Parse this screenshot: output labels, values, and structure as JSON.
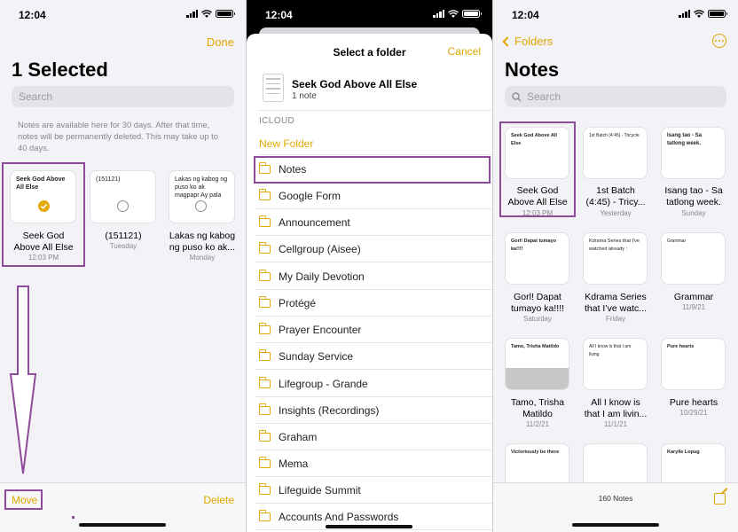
{
  "status": {
    "time": "12:04"
  },
  "panel1": {
    "done": "Done",
    "title": "1 Selected",
    "search_placeholder": "Search",
    "notice": "Notes are available here for 30 days. After that time, notes will be permanently deleted. This may take up to 40 days.",
    "notes": [
      {
        "preview": "Seek God Above All Else",
        "name_line1": "Seek God",
        "name_line2": "Above All Else",
        "date": "12:03 PM",
        "selected": true
      },
      {
        "preview": "(151121)",
        "name_line1": "(151121)",
        "name_line2": "",
        "date": "Tuesday",
        "selected": false
      },
      {
        "preview": "Lakas ng kabog ng puso ko ak magpapr Ay pala",
        "name_line1": "Lakas ng kabog",
        "name_line2": "ng puso ko ak...",
        "date": "Monday",
        "selected": false
      }
    ],
    "move": "Move",
    "delete": "Delete"
  },
  "panel2": {
    "sheet_title": "Select a folder",
    "cancel": "Cancel",
    "selection_title": "Seek God Above All Else",
    "selection_sub": "1 note",
    "section": "ICLOUD",
    "new_folder": "New Folder",
    "folders": [
      "Notes",
      "Google Form",
      "Announcement",
      "Cellgroup (Aisee)",
      "My Daily Devotion",
      "Protégé",
      "Prayer Encounter",
      "Sunday Service",
      "Lifegroup - Grande",
      "Insights (Recordings)",
      "Graham",
      "Mema",
      "Lifeguide Summit",
      "Accounts And Passwords"
    ]
  },
  "panel3": {
    "back": "Folders",
    "title": "Notes",
    "search_placeholder": "Search",
    "notes": [
      {
        "preview": "Seek God Above All Else",
        "name_line1": "Seek God",
        "name_line2": "Above All Else",
        "date": "12:03 PM"
      },
      {
        "preview": "1st Batch (4:45) - Tricycle",
        "name_line1": "1st Batch",
        "name_line2": "(4:45) - Tricy...",
        "date": "Yesterday"
      },
      {
        "preview": "Isang tao - Sa tatlong week.",
        "name_line1": "Isang tao - Sa",
        "name_line2": "tatlong week.",
        "date": "Sunday"
      },
      {
        "preview": "Gorl! Dapat tumayo ka!!!!",
        "name_line1": "Gorl! Dapat",
        "name_line2": "tumayo ka!!!!",
        "date": "Saturday"
      },
      {
        "preview": "Kdrama Series that I've watched already :",
        "name_line1": "Kdrama Series",
        "name_line2": "that I’ve watc...",
        "date": "Friday"
      },
      {
        "preview": "Grammar",
        "name_line1": "Grammar",
        "name_line2": "",
        "date": "11/9/21"
      },
      {
        "preview": "Tamo, Trisha Matildo",
        "name_line1": "Tamo, Trisha",
        "name_line2": "Matildo",
        "date": "11/2/21"
      },
      {
        "preview": "All I know is that I am living",
        "name_line1": "All I know is",
        "name_line2": "that I am livin...",
        "date": "11/1/21"
      },
      {
        "preview": "Pure hearts",
        "name_line1": "Pure hearts",
        "name_line2": "",
        "date": "10/29/21"
      },
      {
        "preview": "Victoriously be there",
        "name_line1": "",
        "name_line2": "",
        "date": ""
      },
      {
        "preview": "",
        "name_line1": "",
        "name_line2": "",
        "date": ""
      },
      {
        "preview": "Karylle Lopug",
        "name_line1": "",
        "name_line2": "",
        "date": ""
      }
    ],
    "count": "160 Notes"
  },
  "colors": {
    "accent": "#e0a800",
    "highlight": "#8e4b9b"
  }
}
